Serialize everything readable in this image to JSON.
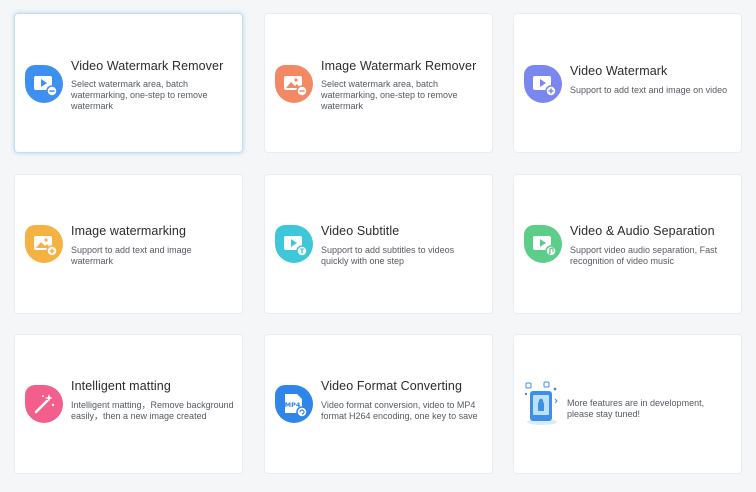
{
  "features": [
    {
      "title": "Video Watermark Remover",
      "desc": "Select watermark area, batch watermarking, one-step to remove watermark",
      "icon": "video-remove-icon",
      "color": "#3d8ff0"
    },
    {
      "title": "Image Watermark Remover",
      "desc": "Select watermark area, batch watermarking, one-step to remove watermark",
      "icon": "image-remove-icon",
      "color": "#f28964"
    },
    {
      "title": "Video Watermark",
      "desc": "Support to add text and image on video",
      "icon": "video-add-icon",
      "color": "#7a87f0"
    },
    {
      "title": "Image watermarking",
      "desc": "Support to add text and image watermark",
      "icon": "image-add-icon",
      "color": "#f6b143"
    },
    {
      "title": "Video Subtitle",
      "desc": "Support to add subtitles to videos quickly with one step",
      "icon": "video-subtitle-icon",
      "color": "#3ec7d8"
    },
    {
      "title": "Video & Audio Separation",
      "desc": "Support video audio separation, Fast recognition of video music",
      "icon": "audio-separation-icon",
      "color": "#5dcd8a"
    },
    {
      "title": "Intelligent matting",
      "desc": "Intelligent matting，Remove background easily，then a new image created",
      "icon": "magic-wand-icon",
      "color": "#f25f8c"
    },
    {
      "title": "Video Format Converting",
      "desc": "Video format conversion, video to MP4 format H264 encoding, one key to save",
      "icon": "mp4-convert-icon",
      "color": "#2f86e8",
      "badge": "MP4"
    }
  ],
  "more": {
    "text": "More features are in development, please stay tuned!",
    "icon": "development-phone-icon"
  }
}
